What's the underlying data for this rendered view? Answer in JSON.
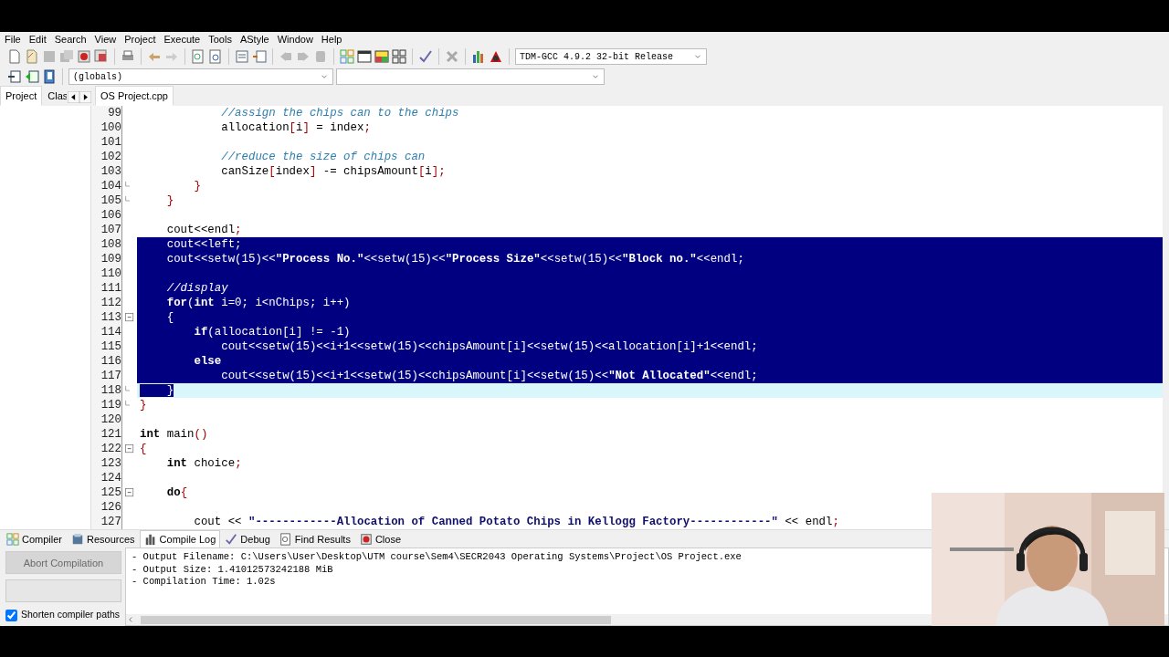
{
  "menu": [
    "File",
    "Edit",
    "Search",
    "View",
    "Project",
    "Execute",
    "Tools",
    "AStyle",
    "Window",
    "Help"
  ],
  "compiler_select": {
    "value": "TDM-GCC 4.9.2 32-bit Release"
  },
  "scope_select": {
    "value": "(globals)"
  },
  "side_tabs": [
    {
      "label": "Project",
      "selected": true
    },
    {
      "label": "Clas",
      "selected": false
    }
  ],
  "editor_tabs": [
    {
      "label": "OS Project.cpp",
      "selected": true
    }
  ],
  "lines": [
    {
      "num": "99",
      "segs": [
        {
          "kind": "comment",
          "t": "            //assign the chips can to the chips"
        }
      ]
    },
    {
      "num": "100",
      "segs": [
        {
          "kind": "code",
          "t": "            allocation[i] = index;"
        }
      ]
    },
    {
      "num": "101"
    },
    {
      "num": "102",
      "segs": [
        {
          "kind": "comment",
          "t": "            //reduce the size of chips can"
        }
      ]
    },
    {
      "num": "103",
      "segs": [
        {
          "kind": "code",
          "t": "            canSize[index] -= chipsAmount[i];"
        }
      ]
    },
    {
      "num": "104",
      "fold_end": true,
      "segs": [
        {
          "kind": "code",
          "t": "        }"
        }
      ]
    },
    {
      "num": "105",
      "fold_end": true,
      "segs": [
        {
          "kind": "code",
          "t": "    }"
        }
      ]
    },
    {
      "num": "106"
    },
    {
      "num": "107",
      "segs": [
        {
          "kind": "code",
          "t": "    cout<<endl;"
        }
      ]
    },
    {
      "num": "108",
      "selected": true,
      "segs": [
        {
          "kind": "code",
          "t": "    cout<<left;"
        }
      ]
    },
    {
      "num": "109",
      "selected": true,
      "segs": [
        {
          "kind": "code",
          "t": "    cout<<setw(15)<<"
        },
        {
          "kind": "string",
          "t": "\"Process No.\""
        },
        {
          "kind": "code",
          "t": "<<setw(15)<<"
        },
        {
          "kind": "string",
          "t": "\"Process Size\""
        },
        {
          "kind": "code",
          "t": "<<setw(15)<<"
        },
        {
          "kind": "string",
          "t": "\"Block no.\""
        },
        {
          "kind": "code",
          "t": "<<endl;"
        }
      ]
    },
    {
      "num": "110",
      "selected": true
    },
    {
      "num": "111",
      "selected": true,
      "segs": [
        {
          "kind": "comment",
          "t": "    //display"
        }
      ]
    },
    {
      "num": "112",
      "selected": true,
      "segs": [
        {
          "kind": "keyword",
          "t": "    for"
        },
        {
          "kind": "code",
          "t": "("
        },
        {
          "kind": "keyword",
          "t": "int"
        },
        {
          "kind": "code",
          "t": " i=0; i<nChips; i++)"
        }
      ]
    },
    {
      "num": "113",
      "selected": true,
      "fold_open": true,
      "segs": [
        {
          "kind": "code",
          "t": "    {"
        }
      ]
    },
    {
      "num": "114",
      "selected": true,
      "segs": [
        {
          "kind": "keyword",
          "t": "        if"
        },
        {
          "kind": "code",
          "t": "(allocation[i] != -1)"
        }
      ]
    },
    {
      "num": "115",
      "selected": true,
      "segs": [
        {
          "kind": "code",
          "t": "            cout<<setw(15)<<i+1<<setw(15)<<chipsAmount[i]<<setw(15)<<allocation[i]+1<<endl;"
        }
      ]
    },
    {
      "num": "116",
      "selected": true,
      "segs": [
        {
          "kind": "keyword",
          "t": "        else"
        }
      ]
    },
    {
      "num": "117",
      "selected": true,
      "segs": [
        {
          "kind": "code",
          "t": "            cout<<setw(15)<<i+1<<setw(15)<<chipsAmount[i]<<setw(15)<<"
        },
        {
          "kind": "string",
          "t": "\"Not Allocated\""
        },
        {
          "kind": "code",
          "t": "<<endl;"
        }
      ]
    },
    {
      "num": "118",
      "selected": true,
      "current": true,
      "fold_end": true,
      "segs": [
        {
          "kind": "code",
          "t": "    }"
        }
      ]
    },
    {
      "num": "119",
      "fold_end": true,
      "segs": [
        {
          "kind": "code",
          "t": "}"
        }
      ]
    },
    {
      "num": "120"
    },
    {
      "num": "121",
      "segs": [
        {
          "kind": "keyword",
          "t": "int"
        },
        {
          "kind": "code",
          "t": " main()"
        }
      ]
    },
    {
      "num": "122",
      "fold_open": true,
      "segs": [
        {
          "kind": "code",
          "t": "{"
        }
      ]
    },
    {
      "num": "123",
      "segs": [
        {
          "kind": "keyword",
          "t": "    int"
        },
        {
          "kind": "code",
          "t": " choice;"
        }
      ]
    },
    {
      "num": "124"
    },
    {
      "num": "125",
      "fold_open": true,
      "segs": [
        {
          "kind": "keyword",
          "t": "    do"
        },
        {
          "kind": "code",
          "t": "{"
        }
      ]
    },
    {
      "num": "126"
    },
    {
      "num": "127",
      "segs": [
        {
          "kind": "code",
          "t": "        cout << "
        },
        {
          "kind": "string",
          "t": "\"------------Allocation of Canned Potato Chips in Kellogg Factory------------\""
        },
        {
          "kind": "code",
          "t": " << endl;"
        }
      ]
    }
  ],
  "bottom_tabs": [
    {
      "label": "Compiler",
      "selected": false
    },
    {
      "label": "Resources",
      "selected": false
    },
    {
      "label": "Compile Log",
      "selected": true
    },
    {
      "label": "Debug",
      "selected": false
    },
    {
      "label": "Find Results",
      "selected": false
    },
    {
      "label": "Close",
      "selected": false
    }
  ],
  "abort_button": {
    "label": "Abort Compilation",
    "disabled": true
  },
  "progress": {
    "level": 0
  },
  "shorten_paths": {
    "label": "Shorten compiler paths",
    "checked": true
  },
  "log": [
    "- Output Filename: C:\\Users\\User\\Desktop\\UTM course\\Sem4\\SECR2043 Operating Systems\\Project\\OS Project.exe",
    "- Output Size: 1.41012573242188 MiB",
    "- Compilation Time: 1.02s"
  ],
  "webcam": {
    "kind": "picture"
  }
}
